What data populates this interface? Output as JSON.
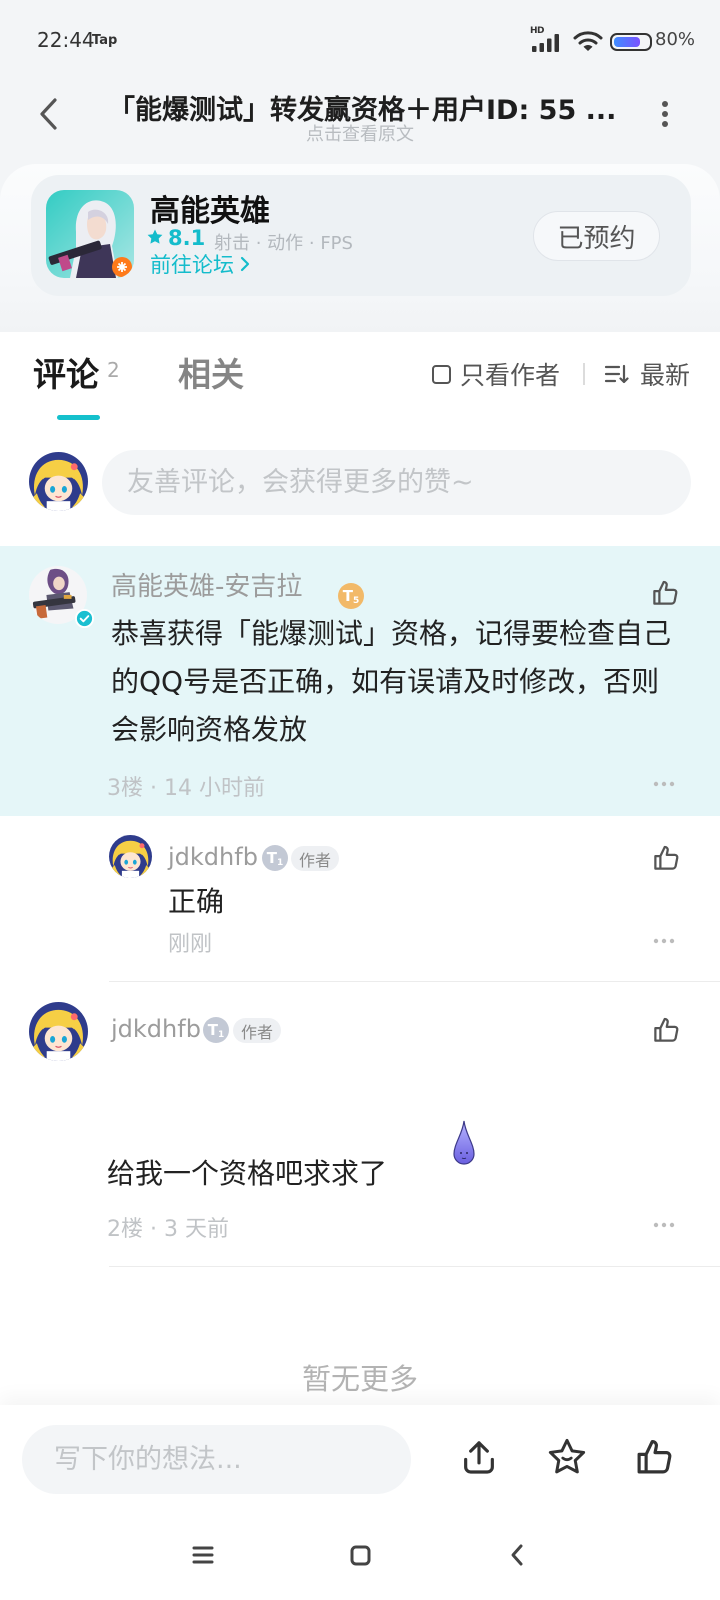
{
  "status_bar": {
    "time": "22:44",
    "app_indicator": "Tap",
    "network_label": "HD",
    "battery": "80%",
    "battery_level": 0.8
  },
  "header": {
    "title": "「能爆测试」转发赢资格＋用户ID: 55 ...",
    "subtitle": "点击查看原文"
  },
  "game_card": {
    "name": "高能英雄",
    "rating": "8.1",
    "tags": "射击 · 动作 · FPS",
    "forum_link": "前往论坛",
    "reserve_button": "已预约"
  },
  "tabs": [
    {
      "label": "评论",
      "count": "2",
      "active": true
    },
    {
      "label": "相关",
      "active": false
    }
  ],
  "filters": {
    "author_only": "只看作者",
    "author_only_checked": false,
    "sort": "最新"
  },
  "comment_box": {
    "placeholder": "友善评论，会获得更多的赞~"
  },
  "comments": [
    {
      "author": "高能英雄-安吉拉",
      "badge_letter": "T",
      "level": "5",
      "verified": true,
      "highlighted": true,
      "text": "恭喜获得「能爆测试」资格，记得要检查自己的QQ号是否正确，如有误请及时修改，否则会影响资格发放",
      "meta": "3楼 · 14 小时前",
      "replies": [
        {
          "author": "jdkdhfb",
          "badge_letter": "T",
          "level": "1",
          "tag": "作者",
          "text": "正确",
          "meta": "刚刚"
        }
      ]
    },
    {
      "author": "jdkdhfb",
      "badge_letter": "T",
      "level": "1",
      "tag": "作者",
      "emoji": "purple-droplet-emoji",
      "text": "给我一个资格吧求求了",
      "meta": "2楼 · 3 天前"
    }
  ],
  "end_of_list": "暂无更多",
  "bottom_bar": {
    "placeholder": "写下你的想法..."
  },
  "icons": {
    "back": "back-arrow-icon",
    "more": "more-vertical-icon",
    "like": "thumbs-up-icon",
    "share": "share-icon",
    "favorite": "star-icon",
    "sort": "sort-icon",
    "nav_menu": "menu-icon",
    "nav_home": "home-icon",
    "nav_back": "nav-back-icon"
  },
  "colors": {
    "accent": "#14c0cc",
    "page_bg": "#f3f5f7",
    "highlight_bg": "#e5f6f8",
    "level_gold": "#f2b968",
    "level_gray": "#c3c9d5",
    "battery_start": "#3f8dff",
    "battery_end": "#7a52ff"
  }
}
